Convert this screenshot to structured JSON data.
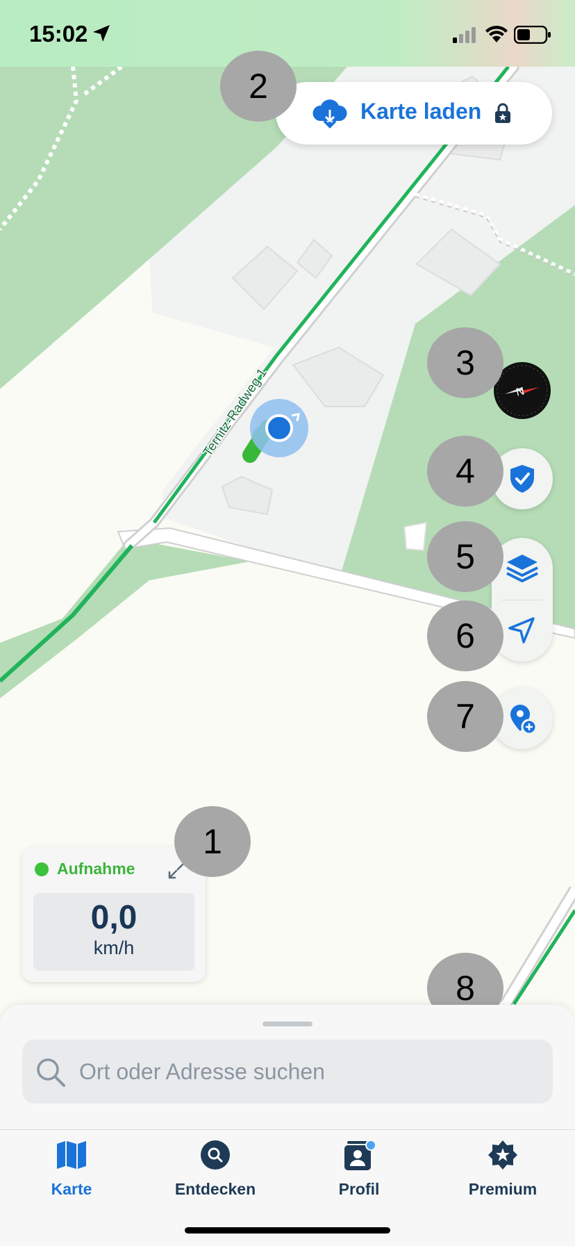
{
  "status_bar": {
    "time": "15:02"
  },
  "map": {
    "street_label": "Ternitz-Radweg 1"
  },
  "load_map": {
    "label": "Karte laden",
    "cloud_icon": "cloud-download-icon",
    "lock_icon": "lock-icon"
  },
  "markers": [
    "1",
    "2",
    "3",
    "4",
    "5",
    "6",
    "7",
    "8"
  ],
  "map_controls": {
    "compass_icon": "compass-icon",
    "shield_icon": "shield-check-icon",
    "layers_icon": "layers-icon",
    "locate_icon": "location-arrow-icon",
    "add_place_icon": "add-location-pin-icon"
  },
  "recording": {
    "label": "Aufnahme",
    "speed": "0,0",
    "unit": "km/h"
  },
  "search": {
    "placeholder": "Ort oder Adresse suchen"
  },
  "tabs": [
    {
      "label": "Karte",
      "icon": "map-icon",
      "active": true
    },
    {
      "label": "Entdecken",
      "icon": "discover-search-icon",
      "active": false
    },
    {
      "label": "Profil",
      "icon": "profile-icon",
      "active": false
    },
    {
      "label": "Premium",
      "icon": "premium-star-icon",
      "active": false
    }
  ],
  "colors": {
    "accent": "#1a73d9",
    "route": "#21b35c",
    "forest": "#b6dcb8",
    "recording": "#3cc23c"
  }
}
